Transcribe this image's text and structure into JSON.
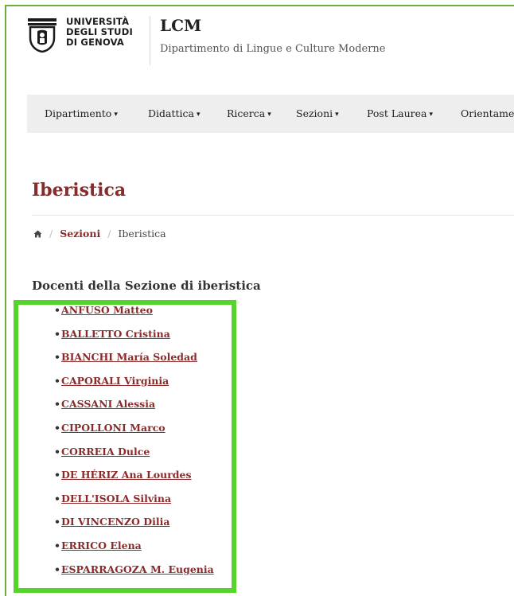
{
  "header": {
    "university_lines": [
      "UNIVERSITÀ",
      "DEGLI STUDI",
      "DI GENOVA"
    ],
    "site_acronym": "LCM",
    "site_name": "Dipartimento di Lingue e Culture Moderne",
    "logo_icon": "university-seal-icon"
  },
  "nav": {
    "items": [
      {
        "label": "Dipartimento",
        "icon": "caret-down-icon"
      },
      {
        "label": "Didattica",
        "icon": "caret-down-icon"
      },
      {
        "label": "Ricerca",
        "icon": "caret-down-icon"
      },
      {
        "label": "Sezioni",
        "icon": "caret-down-icon"
      },
      {
        "label": "Post Laurea",
        "icon": "caret-down-icon"
      },
      {
        "label": "Orientame"
      }
    ]
  },
  "page": {
    "title": "Iberistica"
  },
  "breadcrumb": {
    "home_icon": "home-icon",
    "separator": "/",
    "items": [
      "Sezioni",
      "Iberistica"
    ]
  },
  "section": {
    "heading": "Docenti della Sezione di iberistica",
    "bullet": "•",
    "docenti": [
      "ANFUSO Matteo",
      "BALLETTO Cristina",
      "BIANCHI María Soledad",
      "CAPORALI Virginia",
      "CASSANI Alessia",
      "CIPOLLONI Marco",
      "CORREIA Dulce",
      "DE HÉRIZ Ana Lourdes",
      "DELL'ISOLA Silvina",
      "DI VINCENZO Dilia",
      "ERRICO Elena",
      "ESPARRAGOZA M. Eugenia"
    ]
  },
  "colors": {
    "accent": "#8a2b2b",
    "highlight": "#55d52a",
    "nav_bg": "#eeeeee"
  }
}
